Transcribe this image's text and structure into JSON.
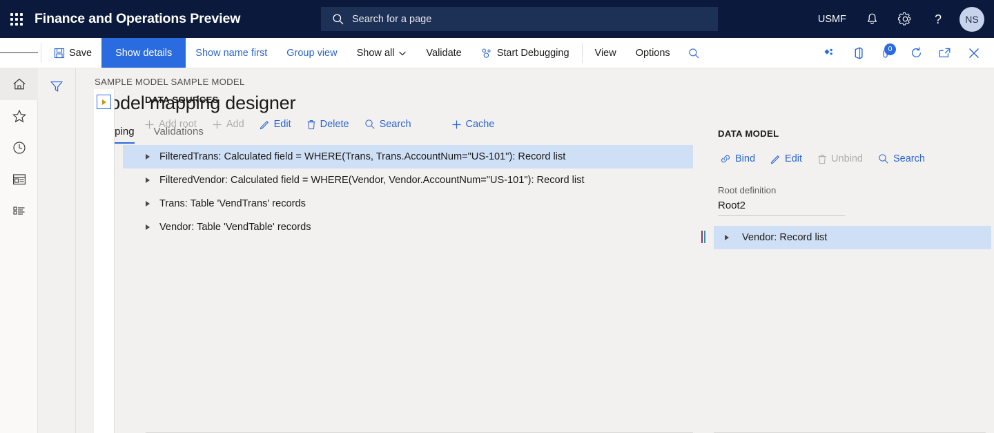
{
  "topnav": {
    "waffle_label": "app-launcher",
    "app_title": "Finance and Operations Preview",
    "search_placeholder": "Search for a page",
    "company": "USMF",
    "notifications_label": "Notifications",
    "settings_label": "Settings",
    "help_label": "Help",
    "avatar_initials": "NS"
  },
  "commandbar": {
    "menu_label": "Navigation menu",
    "save": "Save",
    "show_details": "Show details",
    "show_name_first": "Show name first",
    "group_view": "Group view",
    "show_all": "Show all",
    "validate": "Validate",
    "start_debugging": "Start Debugging",
    "view": "View",
    "options": "Options",
    "search_label": "Search",
    "icons": {
      "diamonds": "power-apps-icon",
      "office": "office-icon",
      "annotations_count": "0",
      "annotations": "attach-annotations-icon",
      "refresh": "refresh-icon",
      "popout": "open-in-new-window-icon",
      "close": "close-icon"
    }
  },
  "rail": {
    "items": [
      {
        "name": "home",
        "label": "Home",
        "selected": true
      },
      {
        "name": "favorites",
        "label": "Favorites",
        "selected": false
      },
      {
        "name": "recent",
        "label": "Recent",
        "selected": false
      },
      {
        "name": "workspaces",
        "label": "Workspaces",
        "selected": false
      },
      {
        "name": "modules",
        "label": "Modules",
        "selected": false
      }
    ],
    "filter_label": "Filter"
  },
  "page": {
    "breadcrumb": "SAMPLE MODEL SAMPLE MODEL",
    "title": "Model mapping designer",
    "tabs": [
      {
        "label": "Mapping",
        "active": true
      },
      {
        "label": "Validations",
        "active": false
      }
    ]
  },
  "data_sources": {
    "expand_label": "Expand panel",
    "heading": "DATA SOURCES",
    "toolbar": [
      {
        "label": "Add root",
        "icon": "plus-icon",
        "disabled": true
      },
      {
        "label": "Add",
        "icon": "plus-icon",
        "disabled": true
      },
      {
        "label": "Edit",
        "icon": "pencil-icon",
        "disabled": false
      },
      {
        "label": "Delete",
        "icon": "trash-icon",
        "disabled": false
      },
      {
        "label": "Search",
        "icon": "search-icon",
        "disabled": false
      },
      {
        "label": "Cache",
        "icon": "plus-icon",
        "disabled": false
      }
    ],
    "rows": [
      {
        "label": "FilteredTrans: Calculated field = WHERE(Trans, Trans.AccountNum=\"US-101\"): Record list",
        "selected": true
      },
      {
        "label": "FilteredVendor: Calculated field = WHERE(Vendor, Vendor.AccountNum=\"US-101\"): Record list",
        "selected": false
      },
      {
        "label": "Trans: Table 'VendTrans' records",
        "selected": false
      },
      {
        "label": "Vendor: Table 'VendTable' records",
        "selected": false
      }
    ]
  },
  "splitter": {
    "label": "Resize panels"
  },
  "data_model": {
    "heading": "DATA MODEL",
    "toolbar": [
      {
        "label": "Bind",
        "icon": "link-icon",
        "disabled": false
      },
      {
        "label": "Edit",
        "icon": "pencil-icon",
        "disabled": false
      },
      {
        "label": "Unbind",
        "icon": "trash-icon",
        "disabled": true
      },
      {
        "label": "Search",
        "icon": "search-icon",
        "disabled": false
      }
    ],
    "root_definition_label": "Root definition",
    "root_definition_value": "Root2",
    "rows": [
      {
        "label": "Vendor: Record list",
        "selected": true
      }
    ]
  },
  "colors": {
    "nav_bg": "#0B1A3C",
    "accent": "#2B6BE0",
    "link": "#2A65CF",
    "page_bg": "#F2F1F0",
    "selection": "#CFE0F6",
    "disabled": "#AEACAA"
  }
}
